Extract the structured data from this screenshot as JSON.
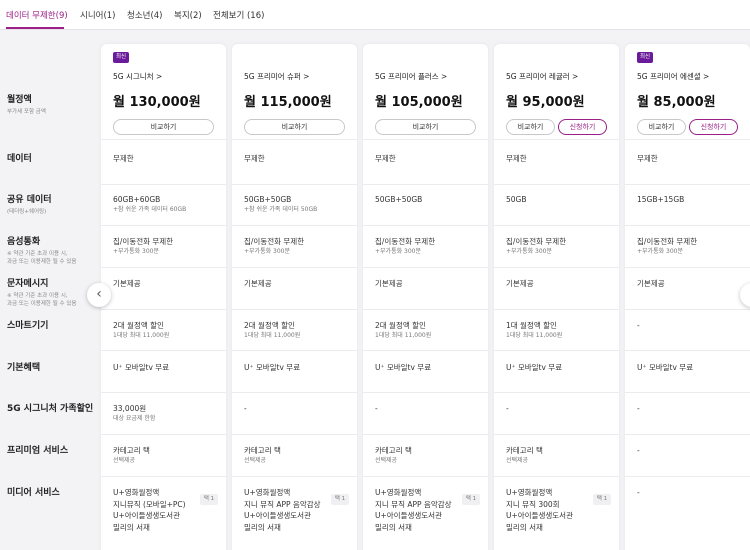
{
  "tabs": [
    {
      "label": "데이터 무제한(9)"
    },
    {
      "label": "시니어(1)"
    },
    {
      "label": "청소년(4)"
    },
    {
      "label": "복지(2)"
    },
    {
      "label": "전체보기 (16)"
    }
  ],
  "rows": [
    {
      "label": "월정액",
      "sub": "부가세 포함 금액"
    },
    {
      "label": "데이터",
      "sub": ""
    },
    {
      "label": "공유 데이터",
      "sub": "(테더링+쉐어링)"
    },
    {
      "label": "음성통화",
      "sub": "※ 약관 기준 초과 이용 시,\n과금 또는 이용제한 될 수 있음"
    },
    {
      "label": "문자메시지",
      "sub": "※ 약관 기준 초과 이용 시,\n과금 또는 이용제한 될 수 있음"
    },
    {
      "label": "스마트기기",
      "sub": ""
    },
    {
      "label": "기본혜택",
      "sub": ""
    },
    {
      "label": "5G 시그니처 가족할인",
      "sub": ""
    },
    {
      "label": "프리미엄 서비스",
      "sub": ""
    },
    {
      "label": "미디어 서비스",
      "sub": ""
    }
  ],
  "compare_label": "비교하기",
  "apply_label": "신청하기",
  "pick_label": "택 1",
  "new_badge": "최신",
  "plans": [
    {
      "badge": "최신",
      "name": "5G 시그니처 >",
      "price": "월 130,000원",
      "has_apply": false,
      "data": "무제한",
      "share": {
        "l1": "60GB+60GB",
        "l2": "+참 쉬운 가족 데이터 60GB"
      },
      "voice": {
        "l1": "집/이동전화 무제한",
        "l2": "+부가통화 300분"
      },
      "sms": "기본제공",
      "smart": {
        "l1": "2대 월정액 할인",
        "l2": "1대당 최대 11,000원"
      },
      "basic": "U⁺ 모바일tv 무료",
      "family": {
        "l1": "33,000원",
        "l2": "대상 요금제 한함"
      },
      "premium": {
        "l1": "카테고리 택",
        "l2": "선택제공"
      },
      "media": [
        "U+영화월정액",
        "지니뮤직 (모바일+PC)",
        "U+아이들생생도서관",
        "밀리의 서재"
      ]
    },
    {
      "badge": "",
      "name": "5G 프리미어 슈퍼 >",
      "price": "월 115,000원",
      "has_apply": false,
      "data": "무제한",
      "share": {
        "l1": "50GB+50GB",
        "l2": "+참 쉬운 가족 데이터 50GB"
      },
      "voice": {
        "l1": "집/이동전화 무제한",
        "l2": "+부가통화 300분"
      },
      "sms": "기본제공",
      "smart": {
        "l1": "2대 월정액 할인",
        "l2": "1대당 최대 11,000원"
      },
      "basic": "U⁺ 모바일tv 무료",
      "family": {
        "l1": "-",
        "l2": ""
      },
      "premium": {
        "l1": "카테고리 택",
        "l2": "선택제공"
      },
      "media": [
        "U+영화월정액",
        "지니 뮤직 APP 음악감상",
        "U+아이들생생도서관",
        "밀리의 서재"
      ]
    },
    {
      "badge": "",
      "name": "5G 프리미어 플러스 >",
      "price": "월 105,000원",
      "has_apply": false,
      "data": "무제한",
      "share": {
        "l1": "50GB+50GB",
        "l2": ""
      },
      "voice": {
        "l1": "집/이동전화 무제한",
        "l2": "+부가통화 300분"
      },
      "sms": "기본제공",
      "smart": {
        "l1": "2대 월정액 할인",
        "l2": "1대당 최대 11,000원"
      },
      "basic": "U⁺ 모바일tv 무료",
      "family": {
        "l1": "-",
        "l2": ""
      },
      "premium": {
        "l1": "카테고리 택",
        "l2": "선택제공"
      },
      "media": [
        "U+영화월정액",
        "지니 뮤직 APP 음악감상",
        "U+아이들생생도서관",
        "밀리의 서재"
      ]
    },
    {
      "badge": "",
      "name": "5G 프리미어 레귤러 >",
      "price": "월 95,000원",
      "has_apply": true,
      "data": "무제한",
      "share": {
        "l1": "50GB",
        "l2": ""
      },
      "voice": {
        "l1": "집/이동전화 무제한",
        "l2": "+부가통화 300분"
      },
      "sms": "기본제공",
      "smart": {
        "l1": "1대 월정액 할인",
        "l2": "1대당 최대 11,000원"
      },
      "basic": "U⁺ 모바일tv 무료",
      "family": {
        "l1": "-",
        "l2": ""
      },
      "premium": {
        "l1": "카테고리 택",
        "l2": "선택제공"
      },
      "media": [
        "U+영화월정액",
        "지니 뮤직 300회",
        "U+아이들생생도서관",
        "밀리의 서재"
      ]
    },
    {
      "badge": "최신",
      "name": "5G 프리미어 에센셜 >",
      "price": "월 85,000원",
      "has_apply": true,
      "data": "무제한",
      "share": {
        "l1": "15GB+15GB",
        "l2": ""
      },
      "voice": {
        "l1": "집/이동전화 무제한",
        "l2": "+부가통화 300분"
      },
      "sms": "기본제공",
      "smart": {
        "l1": "-",
        "l2": ""
      },
      "basic": "U⁺ 모바일tv 무료",
      "family": {
        "l1": "-",
        "l2": ""
      },
      "premium": {
        "l1": "-",
        "l2": ""
      },
      "media": [
        "-"
      ]
    }
  ]
}
